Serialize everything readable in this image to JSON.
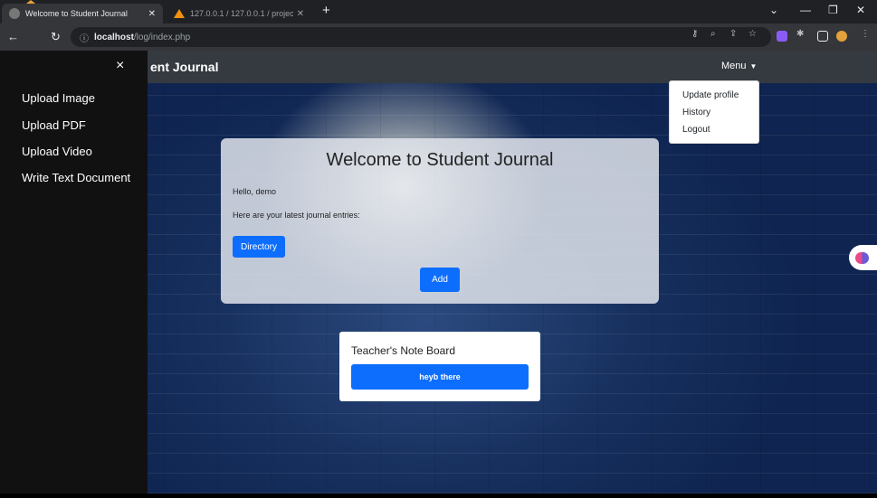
{
  "browser": {
    "tabs": [
      {
        "title": "Welcome to Student Journal",
        "active": true
      },
      {
        "title": "127.0.0.1 / 127.0.0.1 / project / ",
        "active": false
      }
    ],
    "address": {
      "host": "localhost",
      "path": "/log/index.php"
    }
  },
  "navbar": {
    "brand": "ent Journal",
    "menu_label": "Menu"
  },
  "dropdown": {
    "items": [
      "Update profile",
      "History",
      "Logout"
    ]
  },
  "sidenav": {
    "close_glyph": "×",
    "links": [
      "Upload Image",
      "Upload PDF",
      "Upload Video",
      "Write Text Document"
    ]
  },
  "welcome": {
    "title": "Welcome to Student Journal",
    "greeting": "Hello, demo",
    "subtitle": "Here are your latest journal entries:",
    "directory_button": "Directory",
    "add_button": "Add"
  },
  "note_board": {
    "title": "Teacher's Note Board",
    "note": "heyb there"
  },
  "colors": {
    "primary": "#0d6efd",
    "navbar": "#343a40",
    "sidenav": "#111111"
  }
}
